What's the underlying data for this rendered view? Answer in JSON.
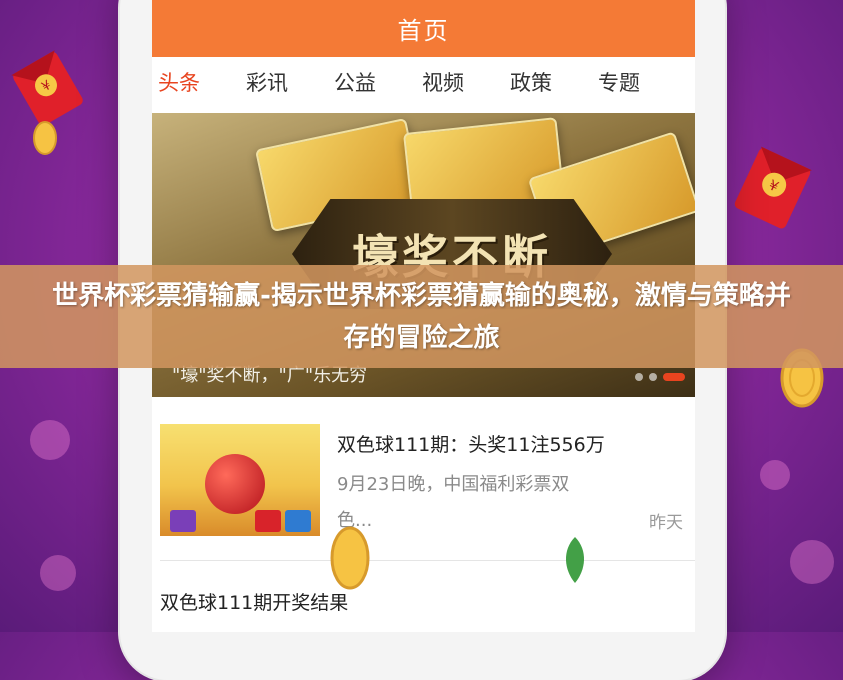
{
  "app": {
    "header_title": "首页",
    "tabs": [
      {
        "label": "头条",
        "active": true
      },
      {
        "label": "彩讯",
        "active": false
      },
      {
        "label": "公益",
        "active": false
      },
      {
        "label": "视频",
        "active": false
      },
      {
        "label": "政策",
        "active": false
      },
      {
        "label": "专题",
        "active": false
      }
    ],
    "banner": {
      "headline": "壕奖不断",
      "caption": "\"壕\"奖不断，\"广\"乐无穷",
      "dots_count": 3,
      "active_dot": 2
    },
    "news": [
      {
        "title": "双色球111期：头奖11注556万",
        "snippet_line1": "9月23日晚，中国福利彩票双",
        "snippet_line2": "色...",
        "time": "昨天"
      },
      {
        "title": "双色球111期开奖结果"
      }
    ]
  },
  "overlay": {
    "title": "世界杯彩票猜输赢-揭示世界杯彩票猜赢输的奥秘，激情与策略并存的冒险之旅"
  },
  "colors": {
    "header": "#f47a36",
    "active_tab": "#e8441f",
    "overlay": "#d2965f"
  },
  "icons": [
    "red-envelope-icon",
    "gold-coin-icon"
  ]
}
